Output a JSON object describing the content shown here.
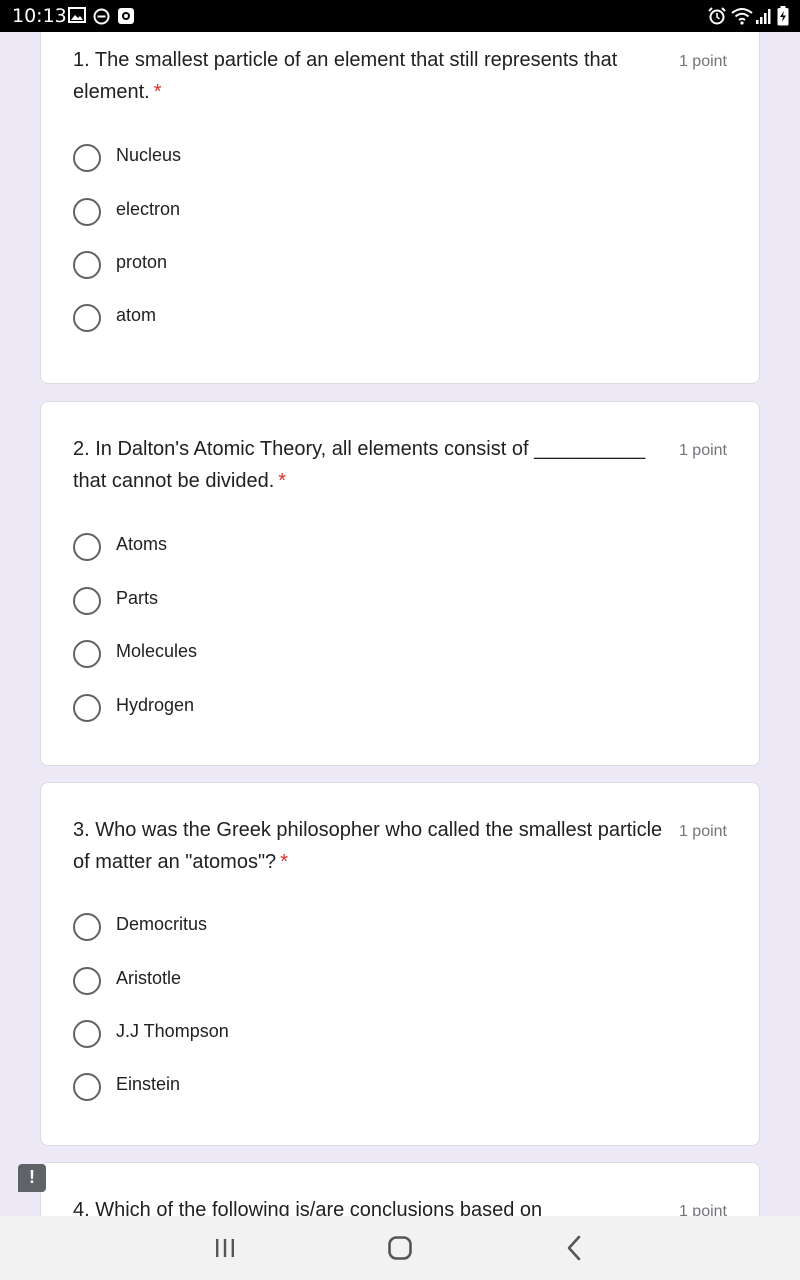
{
  "status_bar": {
    "time": "10:13",
    "left_icons": [
      "image-icon",
      "do-not-disturb-icon",
      "screen-recorder-icon"
    ],
    "right_icons": [
      "alarm-icon",
      "wifi-icon",
      "signal-icon",
      "battery-charging-icon"
    ]
  },
  "questions": [
    {
      "title": "1. The smallest particle of an element that still represents that element.",
      "required_mark": "*",
      "points": "1 point",
      "options": [
        "Nucleus",
        "electron",
        "proton",
        "atom"
      ]
    },
    {
      "title": "2. In Dalton's Atomic Theory, all elements consist of __________ that cannot be divided.",
      "required_mark": "*",
      "points": "1 point",
      "options": [
        "Atoms",
        "Parts",
        "Molecules",
        "Hydrogen"
      ]
    },
    {
      "title": "3. Who was the Greek philosopher who called the smallest particle of matter an \"atomos\"?",
      "required_mark": "*",
      "points": "1 point",
      "options": [
        "Democritus",
        "Aristotle",
        "J.J Thompson",
        "Einstein"
      ]
    },
    {
      "title": "4. Which of the following is/are conclusions based on",
      "points": "1 point"
    }
  ],
  "feedback": {
    "icon": "report-feedback-icon",
    "glyph": "!"
  },
  "nav": {
    "icons": [
      "recent-apps-icon",
      "home-icon",
      "back-icon"
    ]
  },
  "colors": {
    "background": "#ede9f7",
    "required": "#d93025",
    "text": "#202124",
    "muted": "#70757a"
  }
}
